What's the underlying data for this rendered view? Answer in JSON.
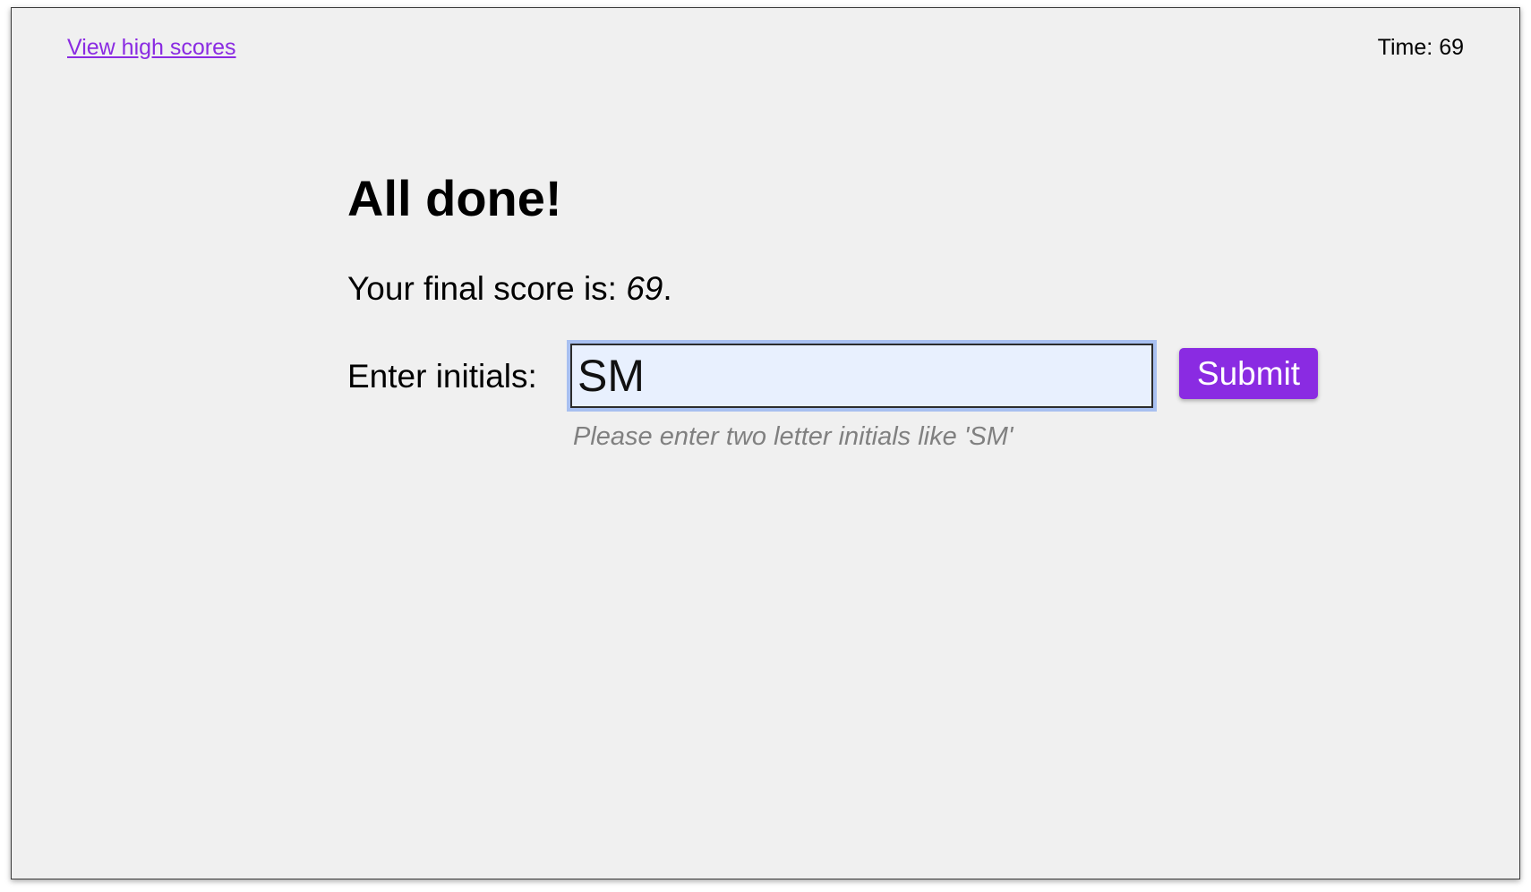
{
  "header": {
    "high_scores_link": "View high scores",
    "timer_label": "Time:",
    "timer_value": "69"
  },
  "main": {
    "title": "All done!",
    "score_prefix": "Your final score is:",
    "score_value": "69",
    "score_suffix": ".",
    "initials_label": "Enter initials:",
    "initials_value": "SM",
    "submit_label": "Submit",
    "hint": "Please enter two letter initials like 'SM'"
  },
  "colors": {
    "accent": "#8a2be2",
    "background": "#f0f0f0",
    "input_background": "#e8f0fe",
    "hint_text": "#808080"
  }
}
